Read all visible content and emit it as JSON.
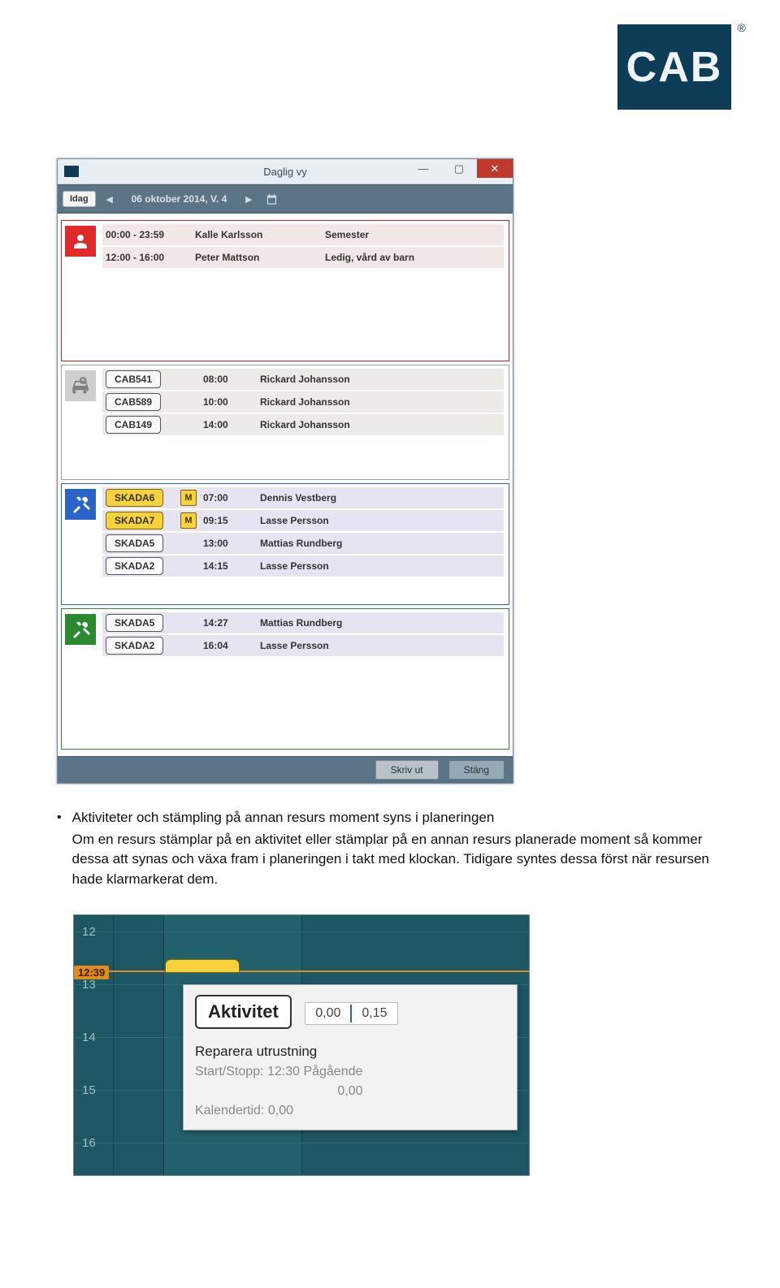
{
  "logo": {
    "text": "CAB",
    "reg": "®"
  },
  "win1": {
    "title": "Daglig vy",
    "nav": {
      "today": "Idag",
      "date": "06 oktober 2014, V. 4"
    },
    "sections": [
      {
        "icon": "person",
        "color": "red",
        "rows": [
          {
            "time": "00:00 - 23:59",
            "person": "Kalle Karlsson",
            "note": "Semester"
          },
          {
            "time": "12:00 - 16:00",
            "person": "Peter Mattson",
            "note": "Ledig, vård av barn"
          }
        ]
      },
      {
        "icon": "car",
        "color": "gray",
        "rows": [
          {
            "code": "CAB541",
            "time": "08:00",
            "person": "Rickard Johansson"
          },
          {
            "code": "CAB589",
            "time": "10:00",
            "person": "Rickard Johansson"
          },
          {
            "code": "CAB149",
            "time": "14:00",
            "person": "Rickard Johansson"
          }
        ]
      },
      {
        "icon": "tools",
        "color": "blue",
        "rows": [
          {
            "code": "SKADA6",
            "yellow": true,
            "m": "M",
            "time": "07:00",
            "person": "Dennis Vestberg"
          },
          {
            "code": "SKADA7",
            "yellow": true,
            "m": "M",
            "time": "09:15",
            "person": "Lasse Persson"
          },
          {
            "code": "SKADA5",
            "time": "13:00",
            "person": "Mattias Rundberg"
          },
          {
            "code": "SKADA2",
            "time": "14:15",
            "person": "Lasse Persson"
          }
        ]
      },
      {
        "icon": "tools",
        "color": "green",
        "rows": [
          {
            "code": "SKADA5",
            "time": "14:27",
            "person": "Mattias Rundberg"
          },
          {
            "code": "SKADA2",
            "time": "16:04",
            "person": "Lasse Persson"
          }
        ]
      }
    ],
    "footer": {
      "print": "Skriv ut",
      "close": "Stäng"
    }
  },
  "body_text": {
    "title": "Aktiviteter och stämpling på annan resurs moment syns i planeringen",
    "body": "Om en resurs stämplar på en aktivitet eller stämplar på en annan resurs planerade moment så kommer dessa att synas och växa fram i planeringen i takt med klockan. Tidigare syntes dessa först när resursen hade klarmarkerat dem."
  },
  "win2": {
    "hours": [
      "12",
      "13",
      "14",
      "15",
      "16"
    ],
    "marker": "12:39",
    "tooltip": {
      "tag": "Aktivitet",
      "val1": "0,00",
      "val2": "0,15",
      "desc": "Reparera utrustning",
      "line1_label": "Start/Stopp:",
      "line1_value": "12:30 Pågående",
      "line2": "0,00",
      "line3_label": "Kalendertid:",
      "line3_value": "0,00"
    }
  }
}
